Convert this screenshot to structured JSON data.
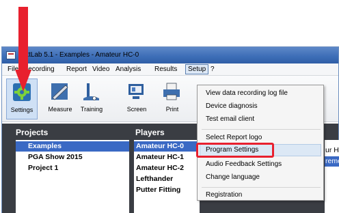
{
  "window": {
    "title": "PuttLab 5.1 - Examples - Amateur HC-0"
  },
  "menubar": {
    "items": [
      "File",
      "Recording",
      "Report",
      "Video",
      "Analysis",
      "Results",
      "Setup",
      "?"
    ]
  },
  "toolbar": {
    "buttons": [
      {
        "label": "Settings",
        "icon": "gear-icon"
      },
      {
        "label": "Measure",
        "icon": "measure-icon"
      },
      {
        "label": "Training",
        "icon": "training-icon"
      },
      {
        "label": "Screen",
        "icon": "screen-icon"
      },
      {
        "label": "Print",
        "icon": "print-icon"
      }
    ]
  },
  "projects": {
    "heading": "Projects",
    "items": [
      "Examples",
      "PGA Show 2015",
      "Project 1"
    ]
  },
  "players": {
    "heading": "Players",
    "items": [
      "Amateur HC-0",
      "Amateur HC-1",
      "Amateur HC-2",
      "Lefthander",
      "Putter Fitting"
    ]
  },
  "right_panel": {
    "line1": "ur HC",
    "line2": "reme"
  },
  "setup_menu": {
    "items": [
      "View data recording log file",
      "Device diagnosis",
      "Test email client",
      "Select Report logo",
      "Program Settings",
      "Audio Feedback Settings",
      "Change language",
      "Registration"
    ]
  },
  "colors": {
    "annotation_red": "#e8202e",
    "selection_blue": "#3a69c4",
    "panel_dark": "#3a3d43"
  }
}
